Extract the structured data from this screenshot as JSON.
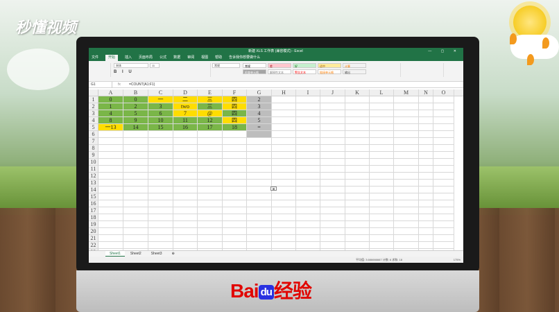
{
  "brand_logo": "秒懂视频",
  "baidu": {
    "bai": "Bai",
    "du": "du",
    "jingyan": "经验"
  },
  "excel": {
    "title": "新建 XLS 工作表 (兼容模式) - Excel",
    "tabs": [
      "文件",
      "开始",
      "插入",
      "页面布局",
      "公式",
      "数据",
      "审阅",
      "视图",
      "帮助",
      "告诉我你想要做什么"
    ],
    "active_tab": "开始",
    "font_name": "宋体",
    "font_size": "11",
    "number_format": "常规",
    "styles": [
      "常规",
      "差",
      "好",
      "适中",
      "计算",
      "检查单元格",
      "解释性文本",
      "警告文本",
      "链接单元格",
      "输出"
    ],
    "name_box": "G1",
    "formula": "=COUNT(A1:F1)",
    "columns": [
      "A",
      "B",
      "C",
      "D",
      "E",
      "F",
      "G",
      "H",
      "I",
      "J",
      "K",
      "L",
      "M",
      "N",
      "O"
    ],
    "rows": [
      [
        "0",
        "0",
        "一",
        "二",
        "三",
        "四",
        "2"
      ],
      [
        "1",
        "2",
        "3",
        "two",
        "三",
        "四",
        "3"
      ],
      [
        "4",
        "5",
        "6",
        "7",
        "@",
        "四",
        "4"
      ],
      [
        "8",
        "9",
        "10",
        "11",
        "12",
        "四",
        "5"
      ],
      [
        "一13",
        "14",
        "15",
        "16",
        "17",
        "18",
        "="
      ]
    ],
    "row_numbers": [
      "1",
      "2",
      "3",
      "4",
      "5",
      "6",
      "7",
      "8",
      "9",
      "10",
      "11",
      "12",
      "13",
      "14",
      "15",
      "16",
      "17",
      "18",
      "19",
      "20",
      "21",
      "22",
      "23"
    ],
    "sheets": [
      "Sheet1",
      "Sheet2",
      "Sheet3"
    ],
    "active_sheet": "Sheet1",
    "status_stats": "平均值: 3.666666667   计数: 6   求和: 18",
    "zoom": "175%",
    "fill_colors": {
      "green": "#7ab648",
      "yellow": "#ffdd00"
    }
  }
}
